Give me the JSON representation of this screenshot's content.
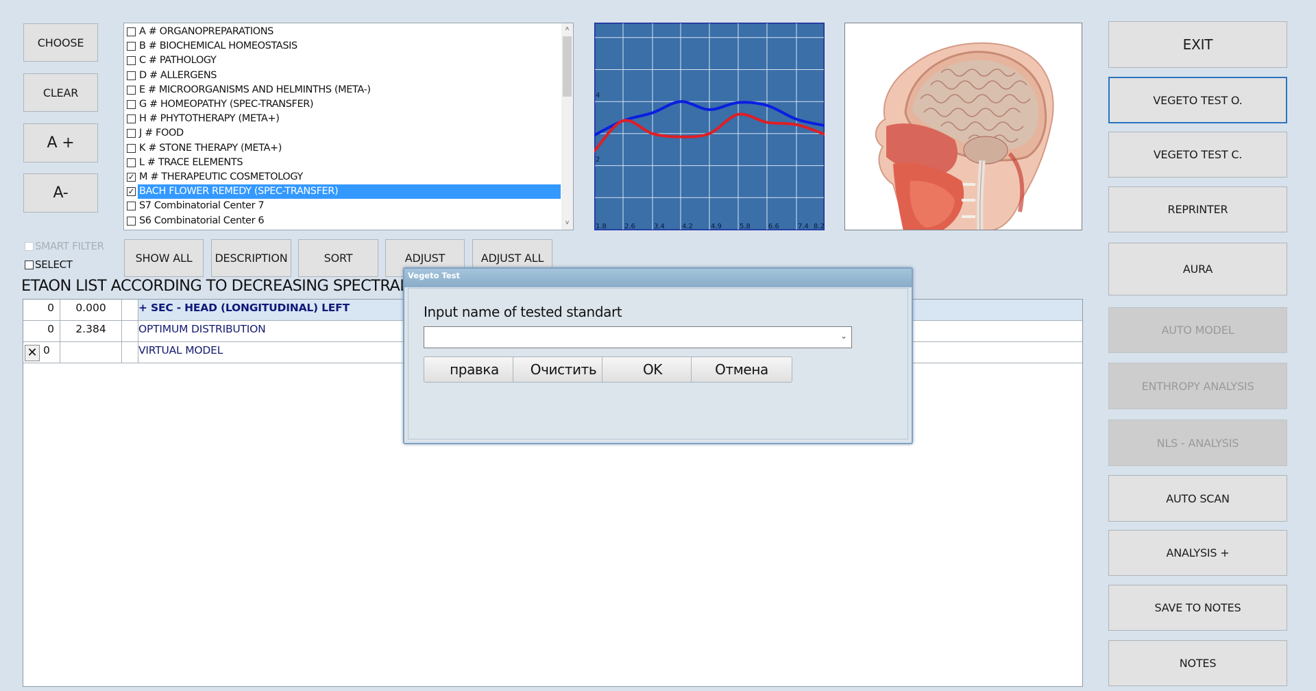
{
  "left_buttons": {
    "choose": "CHOOSE",
    "clear": "CLEAR",
    "font_increase": "A +",
    "font_decrease": "A-"
  },
  "category_list": {
    "items": [
      {
        "label": "A # ORGANOPREPARATIONS",
        "checked": false,
        "selected": false
      },
      {
        "label": "B # BIOCHEMICAL HOMEOSTASIS",
        "checked": false,
        "selected": false
      },
      {
        "label": "C # PATHOLOGY",
        "checked": false,
        "selected": false
      },
      {
        "label": "D # ALLERGENS",
        "checked": false,
        "selected": false
      },
      {
        "label": "E # MICROORGANISMS AND HELMINTHS (META-)",
        "checked": false,
        "selected": false
      },
      {
        "label": "G # HOMEOPATHY (SPEC-TRANSFER)",
        "checked": false,
        "selected": false
      },
      {
        "label": "H # PHYTOTHERAPY (META+)",
        "checked": false,
        "selected": false
      },
      {
        "label": "J # FOOD",
        "checked": false,
        "selected": false
      },
      {
        "label": "K # STONE THERAPY (META+)",
        "checked": false,
        "selected": false
      },
      {
        "label": "L # TRACE ELEMENTS",
        "checked": false,
        "selected": false
      },
      {
        "label": "M # THERAPEUTIC COSMETOLOGY",
        "checked": true,
        "selected": false
      },
      {
        "label": "BACH FLOWER REMEDY (SPEC-TRANSFER)",
        "checked": true,
        "selected": true
      },
      {
        "label": "S7 Combinatorial Center 7",
        "checked": false,
        "selected": false
      },
      {
        "label": "S6 Combinatorial Center 6",
        "checked": false,
        "selected": false
      }
    ],
    "scroll_up_icon": "▲",
    "scroll_down_icon": "▼"
  },
  "filters": {
    "smart_filter": {
      "label": "SMART FILTER",
      "checked": false,
      "enabled": false
    },
    "select": {
      "label": "SELECT",
      "checked": false,
      "enabled": true
    }
  },
  "toolbar": {
    "show_all": "SHOW ALL",
    "description": "DESCRIPTION",
    "sort": "SORT",
    "adjust": "ADJUST",
    "adjust_all": "ADJUST ALL"
  },
  "chart_data": {
    "type": "line",
    "title": "",
    "xlabel": "",
    "ylabel": "",
    "x_tick_labels": [
      "1.8",
      "2.6",
      "3.4",
      "4.2",
      "4.9",
      "5.8",
      "6.6",
      "7.4",
      "8.2"
    ],
    "x": [
      1.8,
      2.6,
      3.4,
      4.2,
      4.9,
      5.8,
      6.6,
      7.4,
      8.2
    ],
    "y_tick_labels": [
      {
        "value": 4,
        "label": "4"
      },
      {
        "value": 2,
        "label": "2"
      }
    ],
    "ylim": [
      0,
      6.5
    ],
    "grid": true,
    "background": "#3a6fa8",
    "series": [
      {
        "name": "blue",
        "color": "#0a1ee0",
        "values": [
          2.95,
          3.4,
          3.65,
          4.0,
          3.75,
          3.97,
          3.88,
          3.45,
          3.25
        ]
      },
      {
        "name": "red",
        "color": "#e01e24",
        "values": [
          2.45,
          3.4,
          3.0,
          2.9,
          3.0,
          3.6,
          3.35,
          3.28,
          2.98
        ]
      }
    ],
    "legend": "none"
  },
  "head_image": {
    "alt": "Sagittal section of human head (brain)"
  },
  "etaon_title": "ETAON LIST ACCORDING TO DECREASING SPECTRAL SIM",
  "results": {
    "rows": [
      {
        "col1": "0",
        "col2": "0.000",
        "col3": "",
        "name": "+ SEC - HEAD (LONGITUDINAL) LEFT",
        "highlight": true,
        "has_x": false
      },
      {
        "col1": "0",
        "col2": "2.384",
        "col3": "",
        "name": "OPTIMUM DISTRIBUTION",
        "highlight": false,
        "has_x": false
      },
      {
        "col1": "0",
        "col2": "",
        "col3": "",
        "name": "VIRTUAL MODEL",
        "highlight": false,
        "has_x": true
      }
    ],
    "close_icon": "✕"
  },
  "right_buttons": [
    {
      "label": "EXIT",
      "enabled": true,
      "focused": false
    },
    {
      "label": "VEGETO TEST O.",
      "enabled": true,
      "focused": true
    },
    {
      "label": "VEGETO TEST C.",
      "enabled": true,
      "focused": false
    },
    {
      "label": "REPRINTER",
      "enabled": true,
      "focused": false
    },
    {
      "label": "AURA",
      "enabled": true,
      "focused": false
    },
    {
      "label": "AUTO MODEL",
      "enabled": false,
      "focused": false
    },
    {
      "label": "ENTHROPY ANALYSIS",
      "enabled": false,
      "focused": false
    },
    {
      "label": "NLS - ANALYSIS",
      "enabled": false,
      "focused": false
    },
    {
      "label": "AUTO SCAN",
      "enabled": true,
      "focused": false
    },
    {
      "label": "ANALYSIS +",
      "enabled": true,
      "focused": false
    },
    {
      "label": "SAVE TO NOTES",
      "enabled": true,
      "focused": false
    },
    {
      "label": "NOTES",
      "enabled": true,
      "focused": false
    }
  ],
  "dialog": {
    "title": "Vegeto Test",
    "prompt": "Input name of tested standart",
    "input_value": "",
    "dropdown_icon": "⌄",
    "buttons": {
      "edit": "правка",
      "clear": "Очистить",
      "ok": "OK",
      "cancel": "Отмена"
    }
  }
}
